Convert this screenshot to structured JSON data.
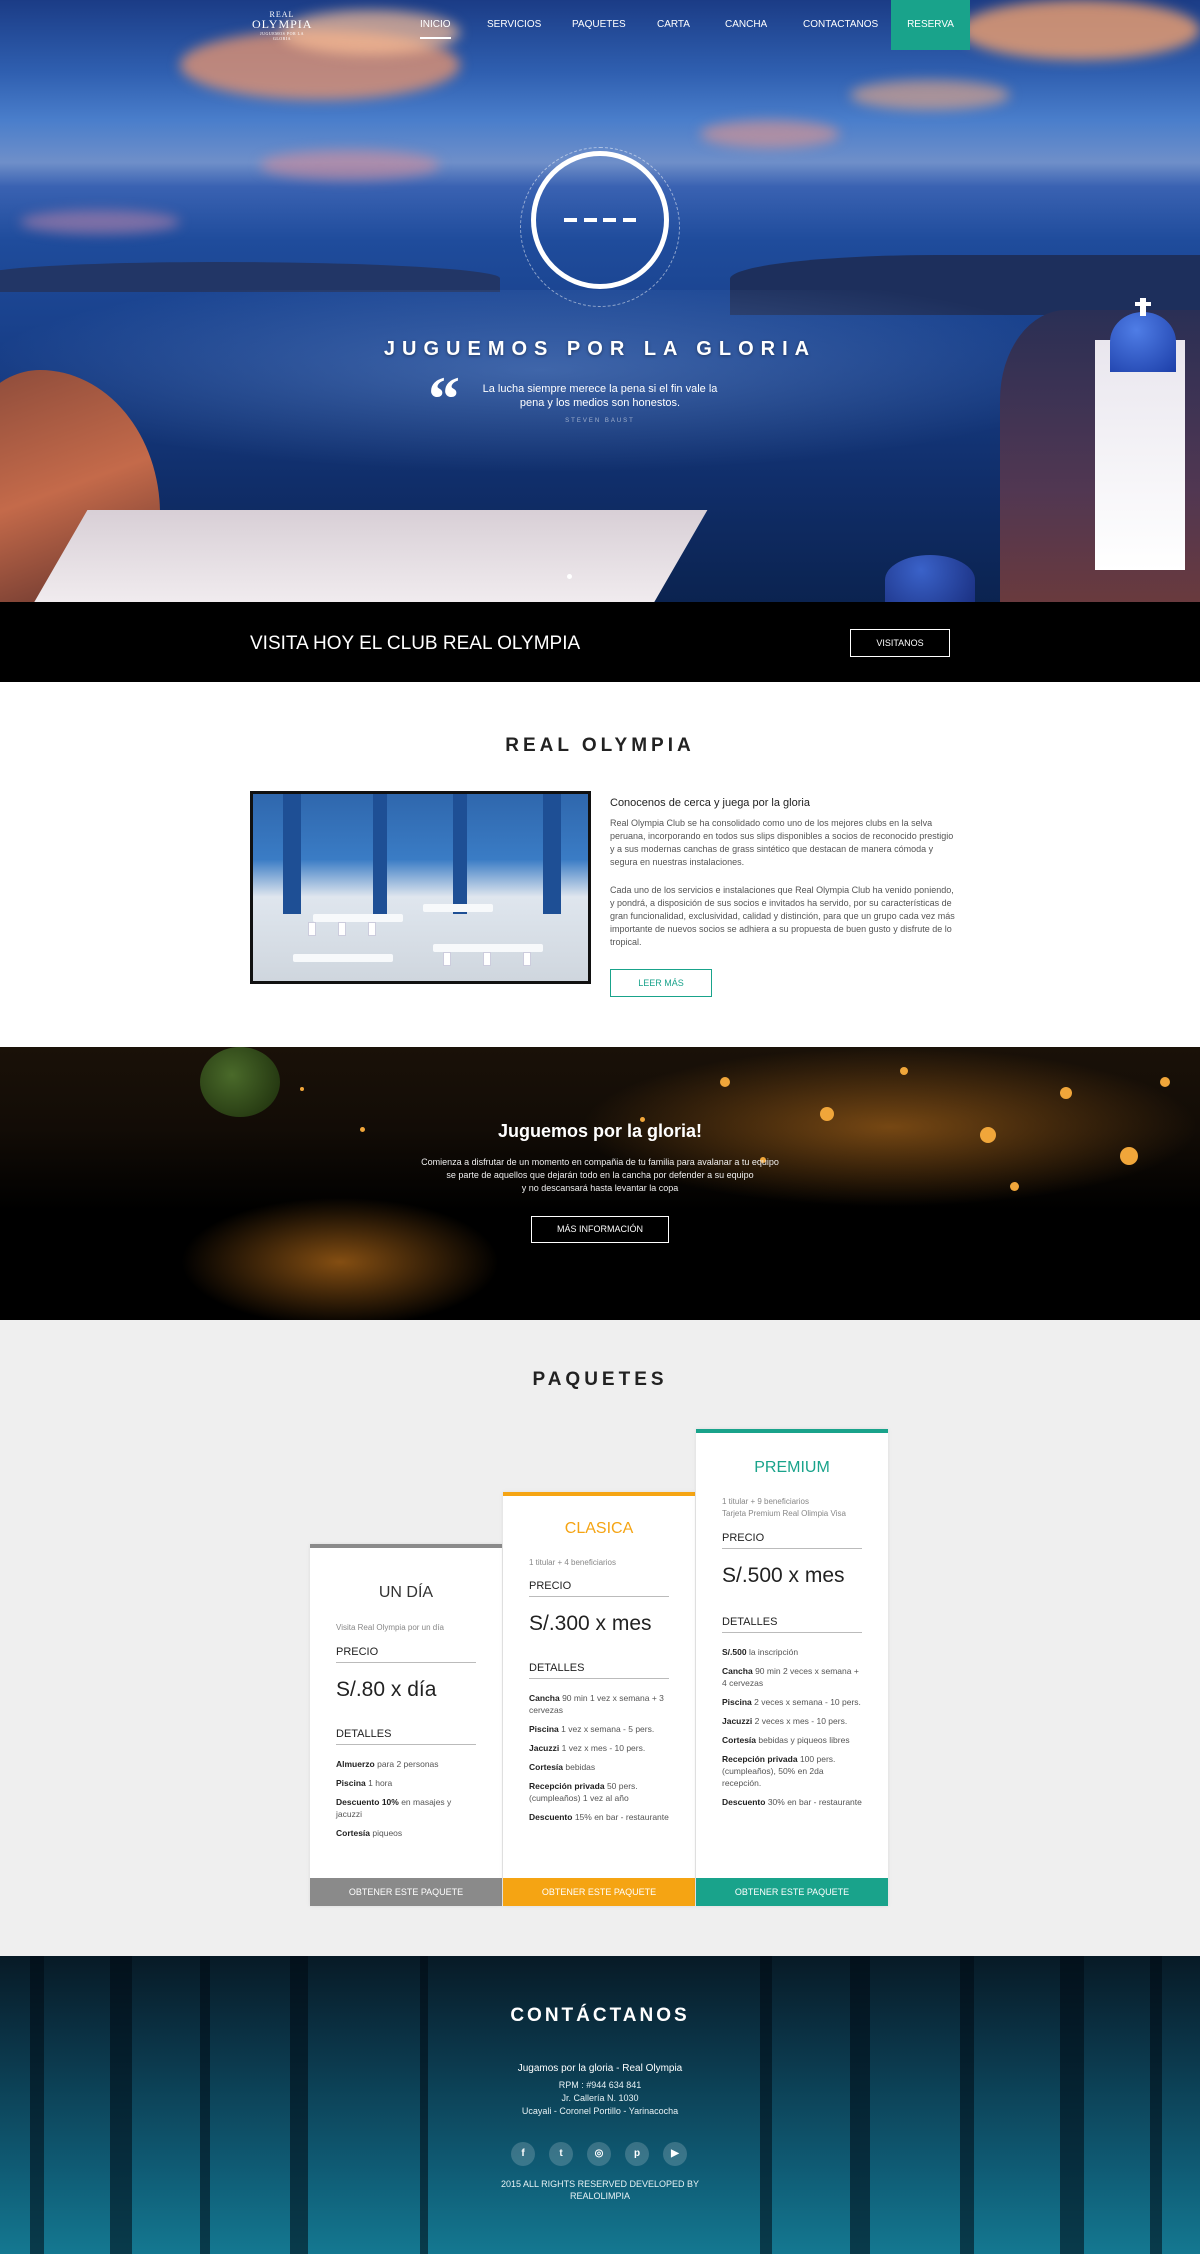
{
  "nav": {
    "logo": {
      "line1": "REAL",
      "line2": "OLYMPIA",
      "line3": "JUGUEMOS POR LA GLORIA"
    },
    "items": [
      "INICIO",
      "SERVICIOS",
      "PAQUETES",
      "CARTA",
      "CANCHA",
      "CONTACTANOS"
    ],
    "active": "INICIO",
    "reserva": "RESERVA"
  },
  "hero": {
    "headline": "JUGUEMOS POR LA GLORIA",
    "quote_line1": "La lucha siempre merece la pena si el fin vale la",
    "quote_line2": "pena y los medios son honestos.",
    "quote_author": "STEVEN BAUST",
    "quote_mark": "“"
  },
  "visit": {
    "text": "VISITA HOY EL CLUB REAL OLYMPIA",
    "button": "VISITANOS"
  },
  "about": {
    "title": "REAL OLYMPIA",
    "subtitle": "Conocenos de cerca y juega por la gloria",
    "p1": "Real Olympia Club se ha consolidado como uno de los mejores clubs en la selva peruana, incorporando en todos sus slips disponibles a socios de reconocido prestigio y a sus modernas canchas de grass sintético que destacan de manera cómoda y segura en nuestras instalaciones.",
    "p2": "Cada uno de los servicios e instalaciones que Real Olympia Club ha venido poniendo, y pondrá, a disposición de sus socios e invitados ha servido, por su características de gran funcionalidad, exclusividad, calidad y distinción, para que un grupo cada vez más importante de nuevos socios se adhiera a su propuesta de buen gusto y disfrute de lo tropical.",
    "button": "LEER MÁS"
  },
  "banner": {
    "title": "Juguemos por la gloria!",
    "line1": "Comienza a disfrutar de un momento en compañia de tu familia para avalanar a tu equipo",
    "line2": "se parte de aquellos que dejarán todo en la cancha por defender a su equipo",
    "line3": "y no descansará hasta levantar la copa",
    "button": "MÁS INFORMACIÓN"
  },
  "packages": {
    "title": "PAQUETES",
    "price_label": "PRECIO",
    "details_label": "DETALLES",
    "cta": "OBTENER ESTE PAQUETE",
    "items": [
      {
        "name": "UN DÍA",
        "color": "#8a8a8a",
        "desc": "Visita Real Olympia por un día",
        "price": "S/.80 x día",
        "details": [
          {
            "b": "Almuerzo",
            "t": " para 2 personas"
          },
          {
            "b": "Piscina",
            "t": " 1 hora"
          },
          {
            "b": "Descuento 10%",
            "t": " en masajes y jacuzzi"
          },
          {
            "b": "Cortesía",
            "t": " piqueos"
          }
        ]
      },
      {
        "name": "CLASICA",
        "color": "#f5a413",
        "desc": "1 titular + 4 beneficiarios",
        "price": "S/.300 x mes",
        "details": [
          {
            "b": "Cancha",
            "t": " 90 min 1 vez x semana + 3 cervezas"
          },
          {
            "b": "Piscina",
            "t": " 1 vez x semana - 5 pers."
          },
          {
            "b": "Jacuzzi",
            "t": " 1 vez x mes - 10 pers."
          },
          {
            "b": "Cortesía",
            "t": " bebidas"
          },
          {
            "b": "Recepción privada",
            "t": " 50 pers. (cumpleaños) 1 vez al año"
          },
          {
            "b": "Descuento",
            "t": " 15% en bar - restaurante"
          }
        ]
      },
      {
        "name": "PREMIUM",
        "color": "#19a38b",
        "desc": "1 titular + 9 beneficiarios",
        "desc2": "Tarjeta Premium Real Olimpia Visa",
        "price": "S/.500 x mes",
        "details": [
          {
            "b": "S/.500",
            "t": " la inscripción"
          },
          {
            "b": "Cancha",
            "t": " 90 min 2 veces x semana + 4 cervezas"
          },
          {
            "b": "Piscina",
            "t": " 2 veces x semana - 10 pers."
          },
          {
            "b": "Jacuzzi",
            "t": " 2 veces x mes - 10 pers."
          },
          {
            "b": "Cortesía",
            "t": " bebidas y piqueos libres"
          },
          {
            "b": "Recepción privada",
            "t": " 100 pers. (cumpleaños), 50% en 2da recepción."
          },
          {
            "b": "Descuento",
            "t": " 30% en bar - restaurante"
          }
        ]
      }
    ]
  },
  "contact": {
    "title": "CONTÁCTANOS",
    "tagline": "Jugamos por la gloria - Real Olympia",
    "rpm": "RPM : #944 634 841",
    "address1": "Jr. Callería N. 1030",
    "address2": "Ucayali - Coronel Portillo - Yarinacocha",
    "social": [
      "facebook-icon",
      "twitter-icon",
      "instagram-icon",
      "pinterest-icon",
      "youtube-icon"
    ],
    "social_glyphs": [
      "f",
      "t",
      "◎",
      "p",
      "▶"
    ],
    "copyright1": "2015 ALL RIGHTS RESERVED DEVELOPED BY",
    "copyright2": "REALOLIMPIA"
  }
}
